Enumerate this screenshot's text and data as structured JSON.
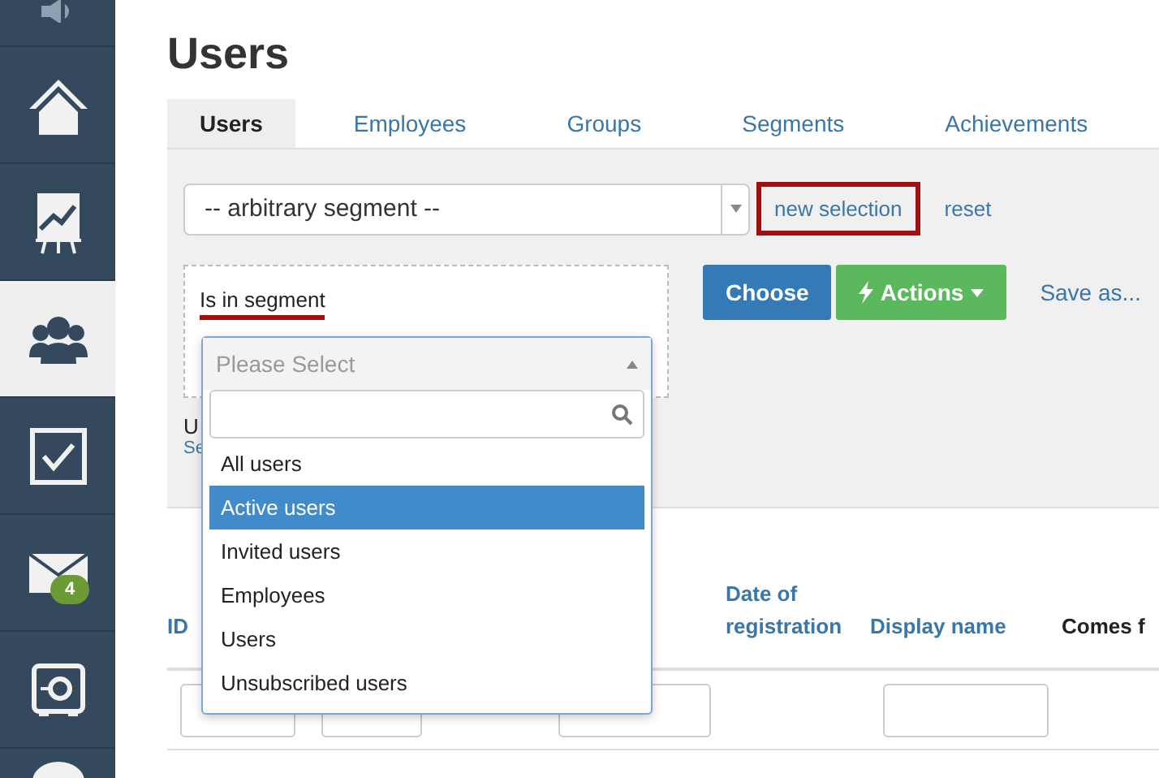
{
  "sidebar": {
    "items": [
      {
        "selected": false
      },
      {
        "selected": false
      },
      {
        "selected": false
      },
      {
        "selected": true
      },
      {
        "selected": false
      },
      {
        "selected": false,
        "badge": "4"
      },
      {
        "selected": false
      },
      {
        "selected": false
      }
    ]
  },
  "title": "Users",
  "tabs": [
    {
      "label": "Users",
      "selected": true
    },
    {
      "label": "Employees",
      "selected": false
    },
    {
      "label": "Groups",
      "selected": false
    },
    {
      "label": "Segments",
      "selected": false
    },
    {
      "label": "Achievements",
      "selected": false
    }
  ],
  "segment_select": {
    "value": "-- arbitrary segment --"
  },
  "links": [
    {
      "label": "new selection",
      "highlighted": true
    },
    {
      "label": "reset",
      "highlighted": false
    }
  ],
  "condition": {
    "label": "Is in segment"
  },
  "buttons": [
    {
      "label": "Choose",
      "kind": "primary"
    },
    {
      "label": "Actions",
      "kind": "success"
    },
    {
      "label": "Save as...",
      "kind": "link"
    }
  ],
  "hidden_texts": [
    "U",
    "Se"
  ],
  "dropdown": {
    "placeholder": "Please Select",
    "options": [
      {
        "label": "All users",
        "selected": false
      },
      {
        "label": "Active users",
        "selected": true
      },
      {
        "label": "Invited users",
        "selected": false
      },
      {
        "label": "Employees",
        "selected": false
      },
      {
        "label": "Users",
        "selected": false
      },
      {
        "label": "Unsubscribed users",
        "selected": false
      }
    ]
  },
  "table": {
    "columns": [
      {
        "label": "ID",
        "sortable": true
      },
      {
        "label": "Date of registration",
        "sortable": true
      },
      {
        "label": "Display name",
        "sortable": true
      },
      {
        "label": "Comes f",
        "sortable": false
      }
    ]
  }
}
